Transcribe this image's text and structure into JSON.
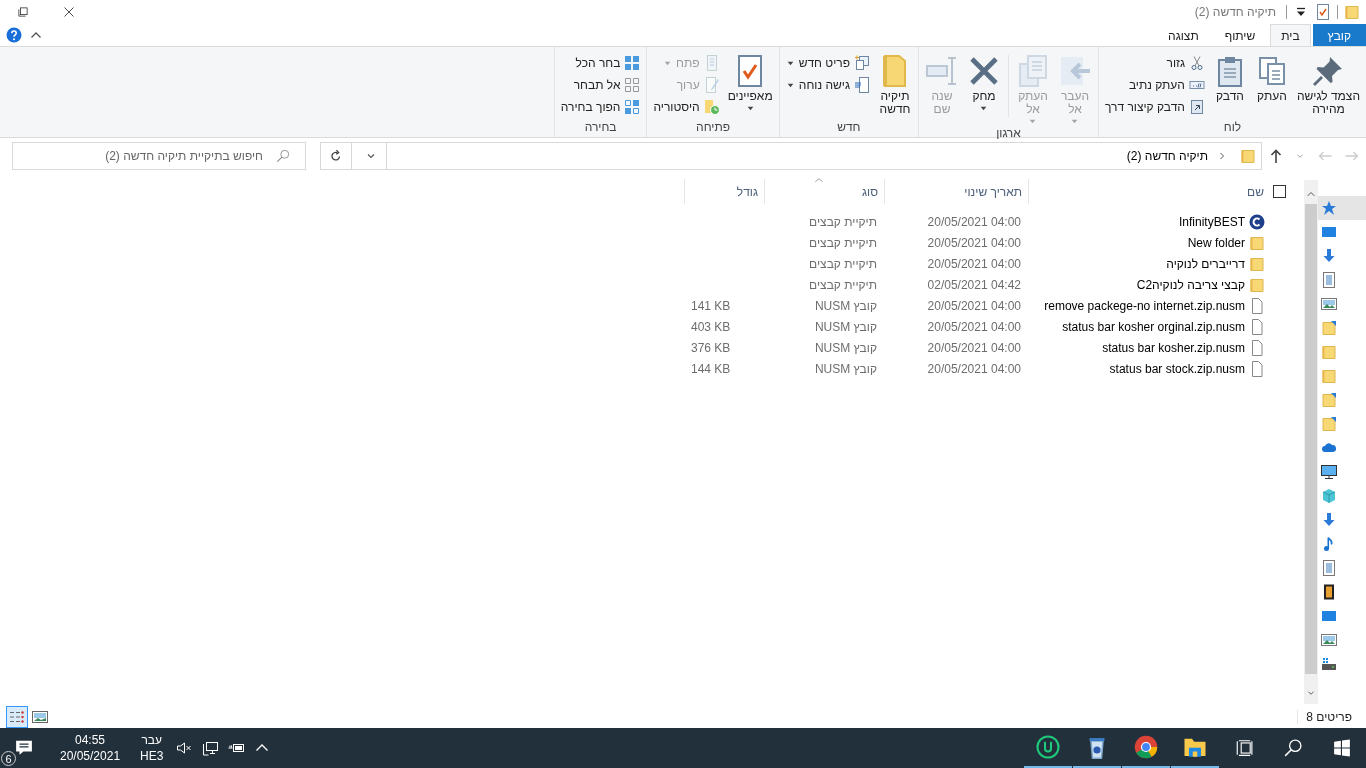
{
  "window": {
    "title": "תיקיה חדשה (2)"
  },
  "tabs": [
    {
      "label": "קובץ",
      "kind": "file",
      "selected": false
    },
    {
      "label": "בית",
      "kind": "tab",
      "selected": true
    },
    {
      "label": "שיתוף",
      "kind": "tab",
      "selected": false
    },
    {
      "label": "תצוגה",
      "kind": "tab",
      "selected": false
    }
  ],
  "ribbon": [
    {
      "label": "לוח",
      "items": [
        {
          "kind": "large",
          "label": "הצמד לגישה\nמהירה",
          "disabled": false
        },
        {
          "kind": "large",
          "label": "העתק",
          "disabled": false
        },
        {
          "kind": "large",
          "label": "הדבק",
          "disabled": false
        },
        {
          "kind": "stack",
          "items": [
            {
              "label": "גזור",
              "disabled": false
            },
            {
              "label": "העתק נתיב",
              "disabled": false
            },
            {
              "label": "הדבק קיצור דרך",
              "disabled": false
            }
          ]
        }
      ]
    },
    {
      "label": "ארגון",
      "items": [
        {
          "kind": "large",
          "label": "העבר\nאל",
          "disabled": true,
          "dropdown": true
        },
        {
          "kind": "large",
          "label": "העתק\nאל",
          "disabled": true,
          "dropdown": true
        },
        {
          "kind": "separator"
        },
        {
          "kind": "large",
          "label": "מחק",
          "disabled": false,
          "dropdown": true
        },
        {
          "kind": "large",
          "label": "שנה\nשם",
          "disabled": true
        }
      ]
    },
    {
      "label": "חדש",
      "items": [
        {
          "kind": "large",
          "label": "תיקיה\nחדשה",
          "disabled": false
        },
        {
          "kind": "stack",
          "items": [
            {
              "label": "פריט חדש",
              "disabled": false,
              "dropdown": true
            },
            {
              "label": "גישה נוחה",
              "disabled": false,
              "dropdown": true
            }
          ]
        }
      ]
    },
    {
      "label": "פתיחה",
      "items": [
        {
          "kind": "large",
          "label": "מאפיינים",
          "disabled": false,
          "dropdown": true
        },
        {
          "kind": "stack",
          "items": [
            {
              "label": "פתח",
              "disabled": true,
              "dropdown": true
            },
            {
              "label": "ערוך",
              "disabled": true
            },
            {
              "label": "היסטוריה",
              "disabled": false
            }
          ]
        }
      ]
    },
    {
      "label": "בחירה",
      "items": [
        {
          "kind": "stack",
          "items": [
            {
              "label": "בחר הכל",
              "disabled": false
            },
            {
              "label": "אל תבחר",
              "disabled": false
            },
            {
              "label": "הפוך בחירה",
              "disabled": false
            }
          ]
        }
      ]
    }
  ],
  "navigation": [
    {
      "disabled": true
    },
    {
      "disabled": true
    },
    {
      "disabled": true
    },
    {
      "disabled": false
    }
  ],
  "address": {
    "path": [
      "תיקיה חדשה (2)"
    ]
  },
  "search": {
    "placeholder": "חיפוש בתיקיית תיקיה חדשה (2)"
  },
  "file_list": {
    "select_all": {
      "checked": false
    },
    "columns": [
      {
        "label": "שם",
        "sorted": false
      },
      {
        "label": "תאריך שינוי",
        "sorted": false
      },
      {
        "label": "סוג",
        "sorted": true
      },
      {
        "label": "גודל",
        "sorted": false
      }
    ],
    "rows": [
      {
        "kind": "app",
        "name": "InfinityBEST",
        "modified": "20/05/2021 04:00",
        "type": "תיקיית קבצים"
      },
      {
        "kind": "folder",
        "name": "New folder",
        "modified": "20/05/2021 04:00",
        "type": "תיקיית קבצים"
      },
      {
        "kind": "folder",
        "name": "דרייברים לנוקיה",
        "modified": "20/05/2021 04:00",
        "type": "תיקיית קבצים"
      },
      {
        "kind": "folder",
        "name": "C2קבצי צריבה לנוקיה",
        "modified": "02/05/2021 04:42",
        "type": "תיקיית קבצים"
      },
      {
        "kind": "file",
        "name": "remove packege-no internet.zip.nusm",
        "modified": "20/05/2021 04:00",
        "type": "קובץ NUSM",
        "size": "141 KB"
      },
      {
        "kind": "file",
        "name": "status bar kosher orginal.zip.nusm",
        "modified": "20/05/2021 04:00",
        "type": "קובץ NUSM",
        "size": "403 KB"
      },
      {
        "kind": "file",
        "name": "status bar kosher.zip.nusm",
        "modified": "20/05/2021 04:00",
        "type": "קובץ NUSM",
        "size": "376 KB"
      },
      {
        "kind": "file",
        "name": "status bar stock.zip.nusm",
        "modified": "20/05/2021 04:00",
        "type": "קובץ NUSM",
        "size": "144 KB"
      }
    ]
  },
  "nav_pane": {
    "items": [
      {
        "selected": true
      },
      {
        "selected": false
      },
      {
        "selected": false
      },
      {
        "selected": false
      },
      {
        "selected": false
      },
      {
        "selected": false
      },
      {
        "selected": false
      },
      {
        "selected": false
      },
      {
        "selected": false
      },
      {
        "selected": false
      },
      {
        "selected": false
      },
      {
        "selected": false
      },
      {
        "selected": false
      },
      {
        "selected": false
      },
      {
        "selected": false
      },
      {
        "selected": false
      },
      {
        "selected": false
      },
      {
        "selected": false
      },
      {
        "selected": false
      },
      {
        "selected": false
      }
    ]
  },
  "status_bar": {
    "count": "8 פריטים",
    "views": [
      {
        "selected": false
      },
      {
        "selected": true
      }
    ]
  },
  "taskbar": {
    "notifications": "6",
    "time": "04:55",
    "date": "20/05/2021",
    "language": "עבר",
    "layout": "HE3",
    "volume_muted": true,
    "apps": [
      {
        "running": true
      },
      {
        "running": true
      },
      {
        "running": true
      },
      {
        "running": true
      }
    ]
  }
}
